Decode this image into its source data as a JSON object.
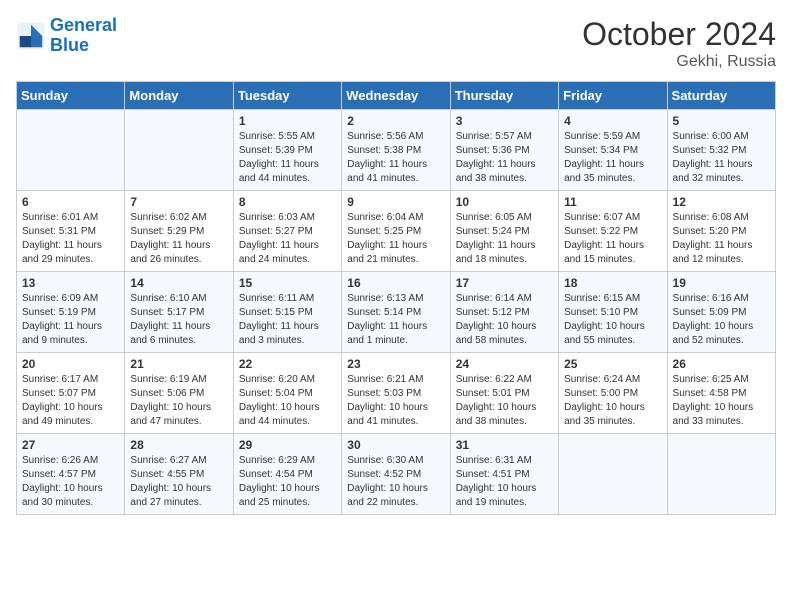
{
  "header": {
    "logo_line1": "General",
    "logo_line2": "Blue",
    "month": "October 2024",
    "location": "Gekhi, Russia"
  },
  "days_of_week": [
    "Sunday",
    "Monday",
    "Tuesday",
    "Wednesday",
    "Thursday",
    "Friday",
    "Saturday"
  ],
  "weeks": [
    [
      {
        "day": "",
        "sunrise": "",
        "sunset": "",
        "daylight": ""
      },
      {
        "day": "",
        "sunrise": "",
        "sunset": "",
        "daylight": ""
      },
      {
        "day": "1",
        "sunrise": "Sunrise: 5:55 AM",
        "sunset": "Sunset: 5:39 PM",
        "daylight": "Daylight: 11 hours and 44 minutes."
      },
      {
        "day": "2",
        "sunrise": "Sunrise: 5:56 AM",
        "sunset": "Sunset: 5:38 PM",
        "daylight": "Daylight: 11 hours and 41 minutes."
      },
      {
        "day": "3",
        "sunrise": "Sunrise: 5:57 AM",
        "sunset": "Sunset: 5:36 PM",
        "daylight": "Daylight: 11 hours and 38 minutes."
      },
      {
        "day": "4",
        "sunrise": "Sunrise: 5:59 AM",
        "sunset": "Sunset: 5:34 PM",
        "daylight": "Daylight: 11 hours and 35 minutes."
      },
      {
        "day": "5",
        "sunrise": "Sunrise: 6:00 AM",
        "sunset": "Sunset: 5:32 PM",
        "daylight": "Daylight: 11 hours and 32 minutes."
      }
    ],
    [
      {
        "day": "6",
        "sunrise": "Sunrise: 6:01 AM",
        "sunset": "Sunset: 5:31 PM",
        "daylight": "Daylight: 11 hours and 29 minutes."
      },
      {
        "day": "7",
        "sunrise": "Sunrise: 6:02 AM",
        "sunset": "Sunset: 5:29 PM",
        "daylight": "Daylight: 11 hours and 26 minutes."
      },
      {
        "day": "8",
        "sunrise": "Sunrise: 6:03 AM",
        "sunset": "Sunset: 5:27 PM",
        "daylight": "Daylight: 11 hours and 24 minutes."
      },
      {
        "day": "9",
        "sunrise": "Sunrise: 6:04 AM",
        "sunset": "Sunset: 5:25 PM",
        "daylight": "Daylight: 11 hours and 21 minutes."
      },
      {
        "day": "10",
        "sunrise": "Sunrise: 6:05 AM",
        "sunset": "Sunset: 5:24 PM",
        "daylight": "Daylight: 11 hours and 18 minutes."
      },
      {
        "day": "11",
        "sunrise": "Sunrise: 6:07 AM",
        "sunset": "Sunset: 5:22 PM",
        "daylight": "Daylight: 11 hours and 15 minutes."
      },
      {
        "day": "12",
        "sunrise": "Sunrise: 6:08 AM",
        "sunset": "Sunset: 5:20 PM",
        "daylight": "Daylight: 11 hours and 12 minutes."
      }
    ],
    [
      {
        "day": "13",
        "sunrise": "Sunrise: 6:09 AM",
        "sunset": "Sunset: 5:19 PM",
        "daylight": "Daylight: 11 hours and 9 minutes."
      },
      {
        "day": "14",
        "sunrise": "Sunrise: 6:10 AM",
        "sunset": "Sunset: 5:17 PM",
        "daylight": "Daylight: 11 hours and 6 minutes."
      },
      {
        "day": "15",
        "sunrise": "Sunrise: 6:11 AM",
        "sunset": "Sunset: 5:15 PM",
        "daylight": "Daylight: 11 hours and 3 minutes."
      },
      {
        "day": "16",
        "sunrise": "Sunrise: 6:13 AM",
        "sunset": "Sunset: 5:14 PM",
        "daylight": "Daylight: 11 hours and 1 minute."
      },
      {
        "day": "17",
        "sunrise": "Sunrise: 6:14 AM",
        "sunset": "Sunset: 5:12 PM",
        "daylight": "Daylight: 10 hours and 58 minutes."
      },
      {
        "day": "18",
        "sunrise": "Sunrise: 6:15 AM",
        "sunset": "Sunset: 5:10 PM",
        "daylight": "Daylight: 10 hours and 55 minutes."
      },
      {
        "day": "19",
        "sunrise": "Sunrise: 6:16 AM",
        "sunset": "Sunset: 5:09 PM",
        "daylight": "Daylight: 10 hours and 52 minutes."
      }
    ],
    [
      {
        "day": "20",
        "sunrise": "Sunrise: 6:17 AM",
        "sunset": "Sunset: 5:07 PM",
        "daylight": "Daylight: 10 hours and 49 minutes."
      },
      {
        "day": "21",
        "sunrise": "Sunrise: 6:19 AM",
        "sunset": "Sunset: 5:06 PM",
        "daylight": "Daylight: 10 hours and 47 minutes."
      },
      {
        "day": "22",
        "sunrise": "Sunrise: 6:20 AM",
        "sunset": "Sunset: 5:04 PM",
        "daylight": "Daylight: 10 hours and 44 minutes."
      },
      {
        "day": "23",
        "sunrise": "Sunrise: 6:21 AM",
        "sunset": "Sunset: 5:03 PM",
        "daylight": "Daylight: 10 hours and 41 minutes."
      },
      {
        "day": "24",
        "sunrise": "Sunrise: 6:22 AM",
        "sunset": "Sunset: 5:01 PM",
        "daylight": "Daylight: 10 hours and 38 minutes."
      },
      {
        "day": "25",
        "sunrise": "Sunrise: 6:24 AM",
        "sunset": "Sunset: 5:00 PM",
        "daylight": "Daylight: 10 hours and 35 minutes."
      },
      {
        "day": "26",
        "sunrise": "Sunrise: 6:25 AM",
        "sunset": "Sunset: 4:58 PM",
        "daylight": "Daylight: 10 hours and 33 minutes."
      }
    ],
    [
      {
        "day": "27",
        "sunrise": "Sunrise: 6:26 AM",
        "sunset": "Sunset: 4:57 PM",
        "daylight": "Daylight: 10 hours and 30 minutes."
      },
      {
        "day": "28",
        "sunrise": "Sunrise: 6:27 AM",
        "sunset": "Sunset: 4:55 PM",
        "daylight": "Daylight: 10 hours and 27 minutes."
      },
      {
        "day": "29",
        "sunrise": "Sunrise: 6:29 AM",
        "sunset": "Sunset: 4:54 PM",
        "daylight": "Daylight: 10 hours and 25 minutes."
      },
      {
        "day": "30",
        "sunrise": "Sunrise: 6:30 AM",
        "sunset": "Sunset: 4:52 PM",
        "daylight": "Daylight: 10 hours and 22 minutes."
      },
      {
        "day": "31",
        "sunrise": "Sunrise: 6:31 AM",
        "sunset": "Sunset: 4:51 PM",
        "daylight": "Daylight: 10 hours and 19 minutes."
      },
      {
        "day": "",
        "sunrise": "",
        "sunset": "",
        "daylight": ""
      },
      {
        "day": "",
        "sunrise": "",
        "sunset": "",
        "daylight": ""
      }
    ]
  ]
}
